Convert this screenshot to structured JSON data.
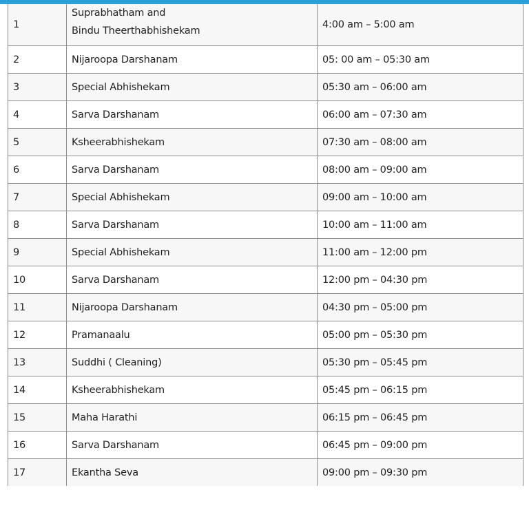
{
  "schedule": {
    "rows": [
      {
        "num": "1",
        "name_line1": "Suprabhatham and",
        "name_line2": "Bindu Theerthabhishekam",
        "time": "4:00 am – 5:00 am"
      },
      {
        "num": "2",
        "name": "Nijaroopa Darshanam",
        "time": "05: 00 am – 05:30 am"
      },
      {
        "num": "3",
        "name": "Special Abhishekam",
        "time": "05:30 am – 06:00 am"
      },
      {
        "num": "4",
        "name": "Sarva Darshanam",
        "time": "06:00 am – 07:30 am"
      },
      {
        "num": "5",
        "name": "Ksheerabhishekam",
        "time": "07:30 am – 08:00 am"
      },
      {
        "num": "6",
        "name": "Sarva Darshanam",
        "time": "08:00 am – 09:00 am"
      },
      {
        "num": "7",
        "name": "Special Abhishekam",
        "time": "09:00 am – 10:00 am"
      },
      {
        "num": "8",
        "name": "Sarva Darshanam",
        "time": "10:00 am – 11:00 am"
      },
      {
        "num": "9",
        "name": "Special Abhishekam",
        "time": "11:00 am – 12:00 pm"
      },
      {
        "num": "10",
        "name": "Sarva Darshanam",
        "time": "12:00 pm – 04:30 pm"
      },
      {
        "num": "11",
        "name": "Nijaroopa Darshanam",
        "time": "04:30 pm – 05:00 pm"
      },
      {
        "num": "12",
        "name": "Pramanaalu",
        "time": "05:00 pm – 05:30 pm"
      },
      {
        "num": "13",
        "name": "Suddhi ( Cleaning)",
        "time": "05:30 pm – 05:45 pm"
      },
      {
        "num": "14",
        "name": "Ksheerabhishekam",
        "time": "05:45 pm – 06:15 pm"
      },
      {
        "num": "15",
        "name": "Maha Harathi",
        "time": "06:15 pm – 06:45 pm"
      },
      {
        "num": "16",
        "name": "Sarva Darshanam",
        "time": "06:45 pm – 09:00 pm"
      },
      {
        "num": "17",
        "name": "Ekantha Seva",
        "time": "09:00 pm – 09:30 pm"
      }
    ]
  },
  "colors": {
    "top_bar": "#2a9fd8",
    "row_odd": "#f7f7f7",
    "row_even": "#ffffff",
    "border": "#8f8f8f"
  }
}
